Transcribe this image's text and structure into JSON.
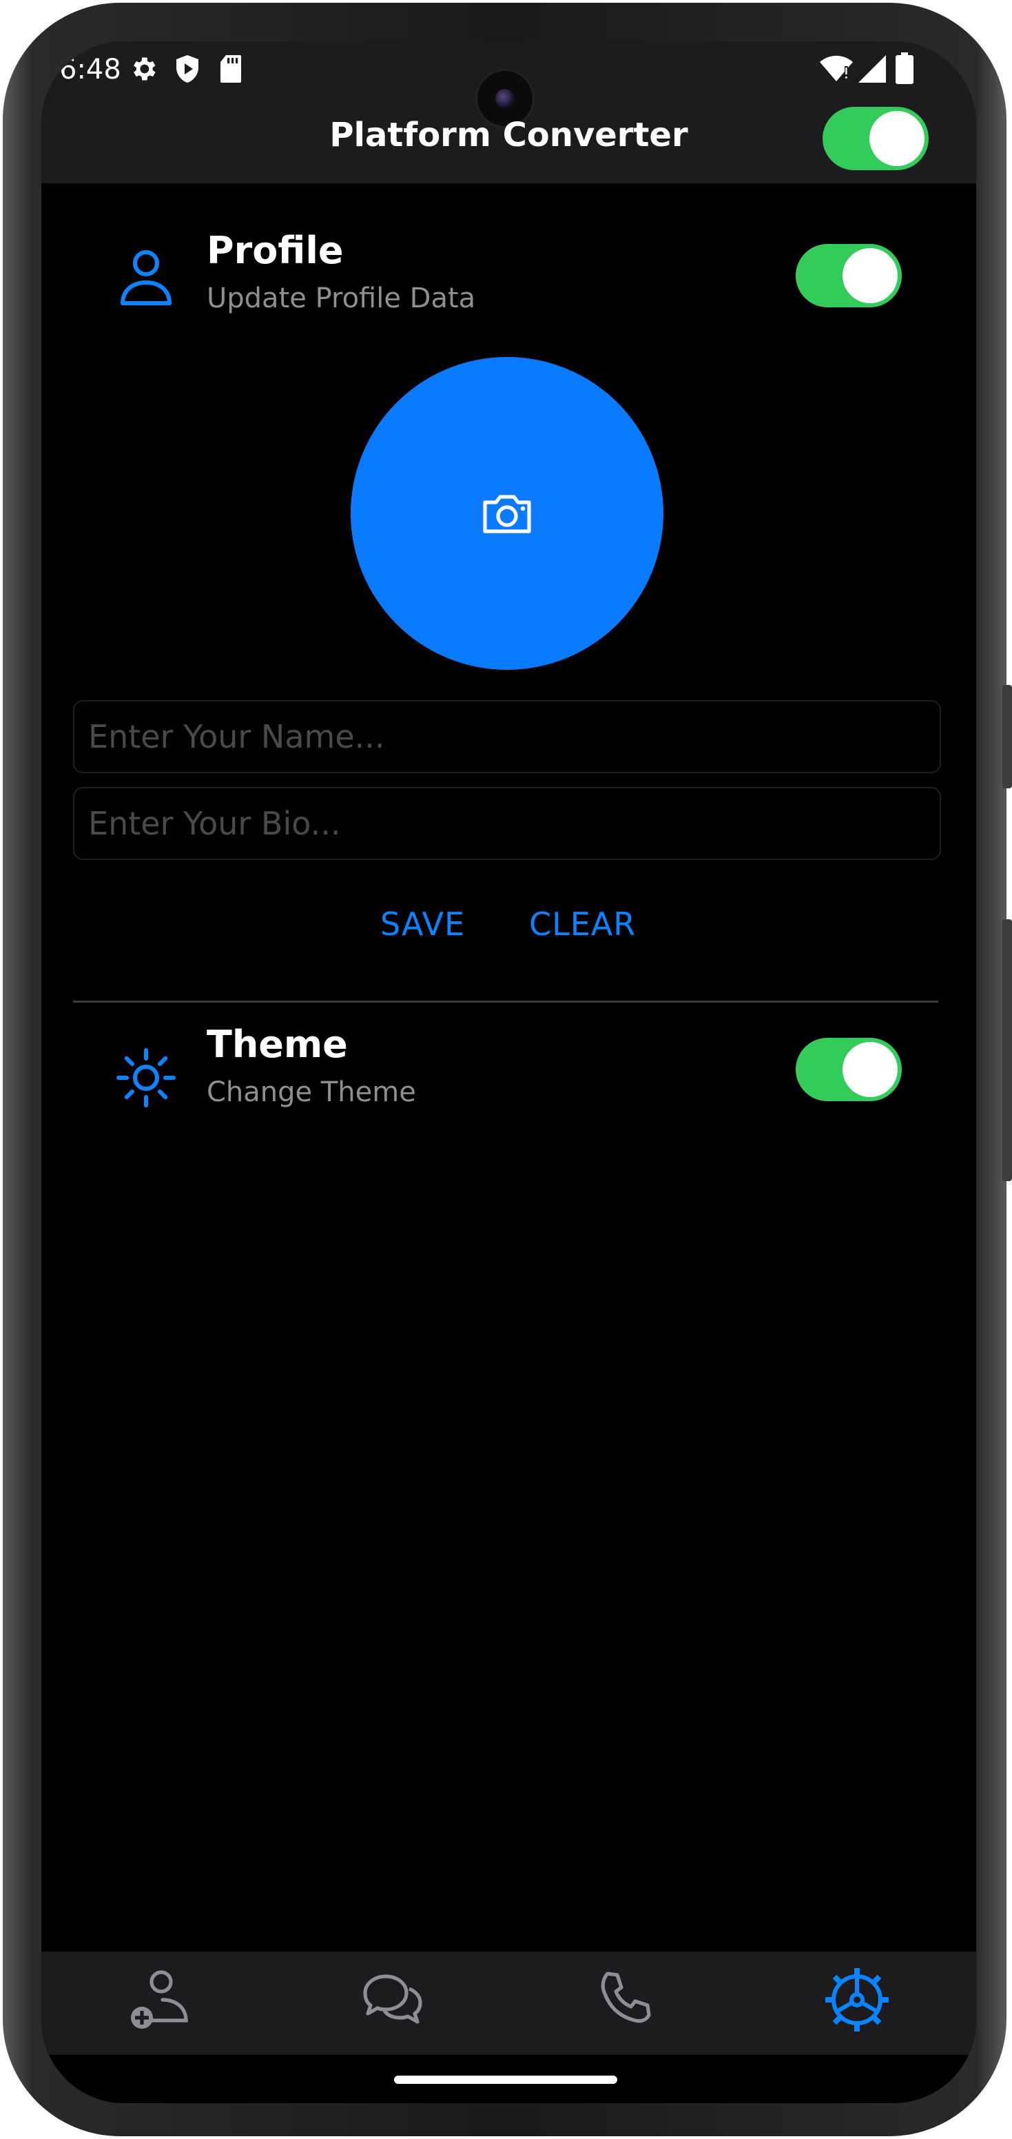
{
  "status_bar": {
    "time": "6:48"
  },
  "app_bar": {
    "title": "Platform Converter",
    "platform_switch_on": true
  },
  "profile_section": {
    "title": "Profile",
    "subtitle": "Update Profile Data",
    "switch_on": true,
    "avatar_icon": "camera-icon",
    "name_placeholder": "Enter Your Name...",
    "name_value": "",
    "bio_placeholder": "Enter Your Bio...",
    "bio_value": "",
    "save_label": "SAVE",
    "clear_label": "CLEAR"
  },
  "theme_section": {
    "title": "Theme",
    "subtitle": "Change Theme",
    "switch_on": true
  },
  "bottom_nav": {
    "items": [
      {
        "icon": "add-contact-icon",
        "active": false
      },
      {
        "icon": "chat-icon",
        "active": false
      },
      {
        "icon": "phone-icon",
        "active": false
      },
      {
        "icon": "settings-icon",
        "active": true
      }
    ]
  },
  "colors": {
    "accent": "#0a84ff",
    "switch_on": "#33cc5a",
    "background": "#000000",
    "bar": "#1c1c1e",
    "inactive_icon": "#8e8e93"
  }
}
